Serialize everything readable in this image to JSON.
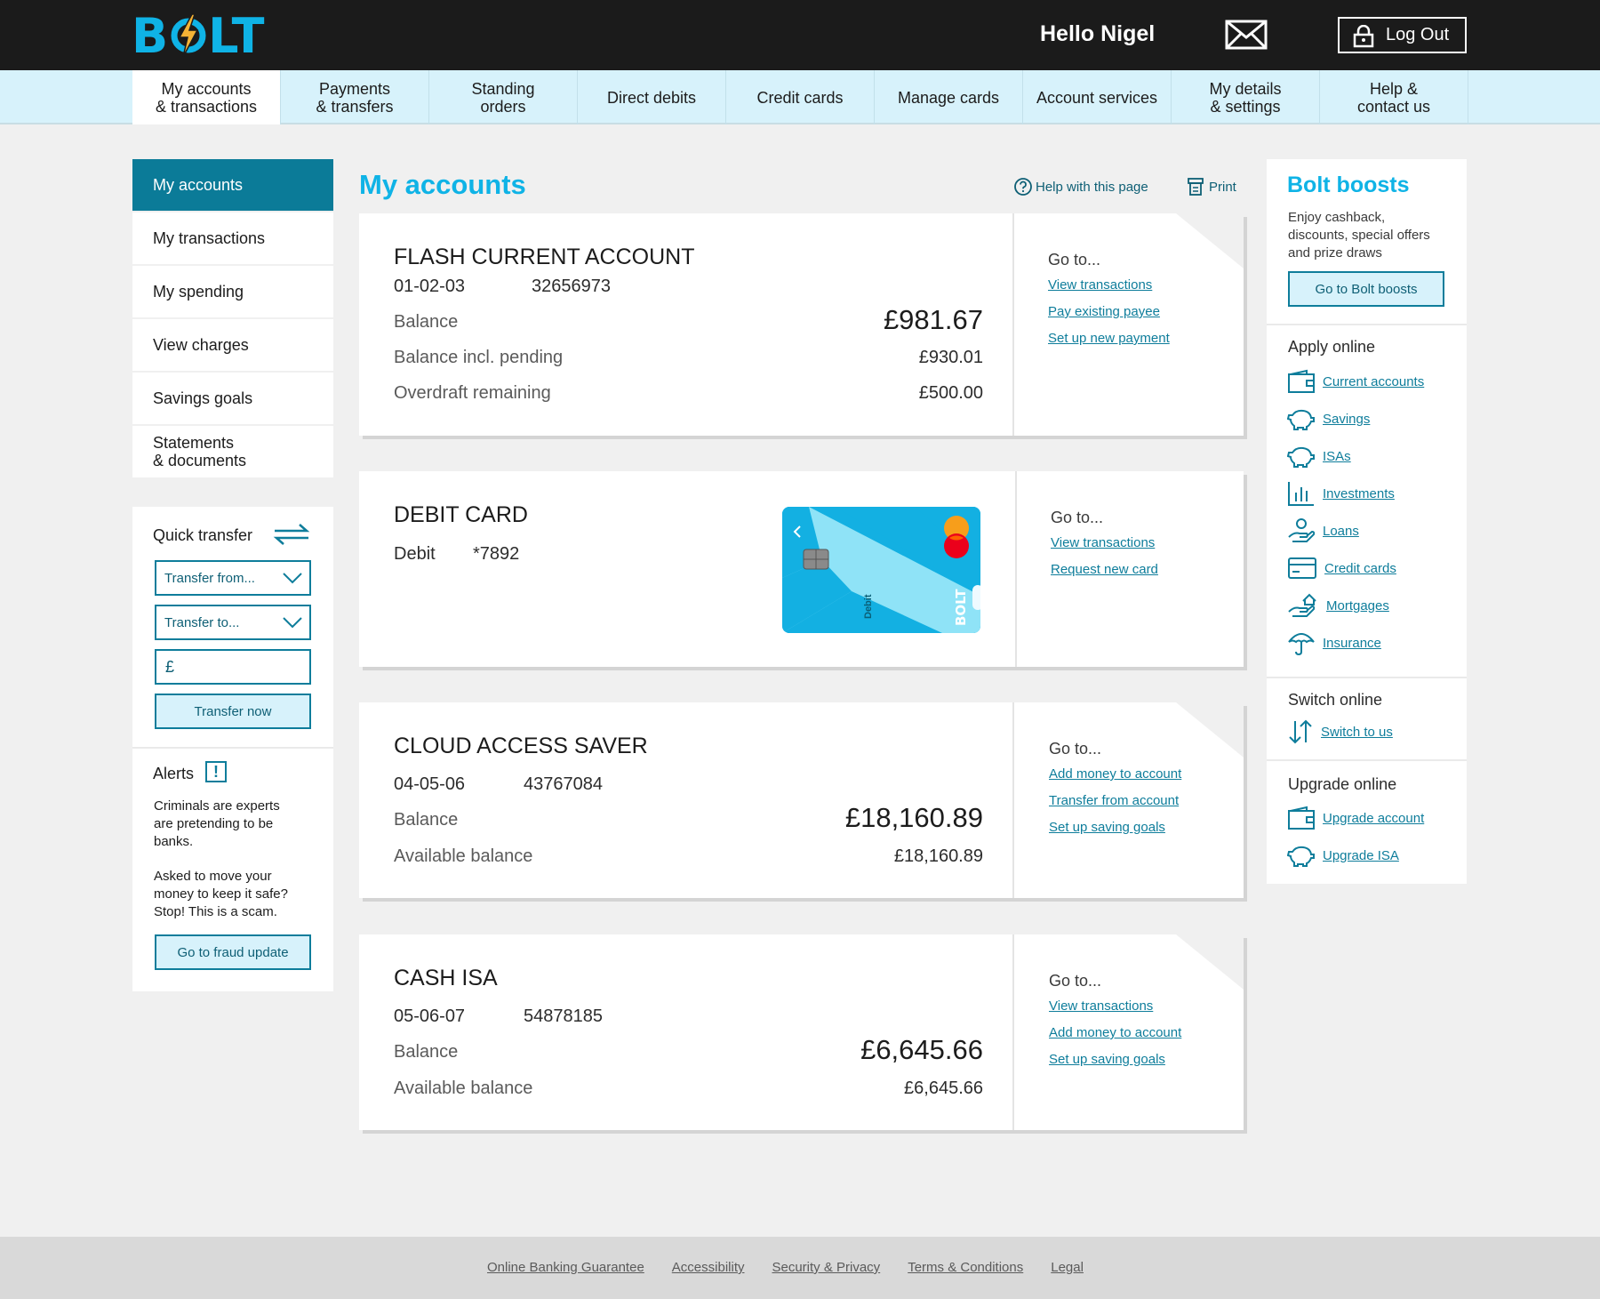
{
  "header": {
    "logo_text": "BOLT",
    "greeting": "Hello Nigel",
    "logout_label": "Log Out",
    "colors": {
      "bar": "#1b1b1b",
      "brand": "#0fb3e6",
      "bolt": "#f5b335"
    }
  },
  "nav": {
    "items": [
      {
        "label": "My accounts\n& transactions",
        "active": true
      },
      {
        "label": "Payments\n& transfers"
      },
      {
        "label": "Standing\norders"
      },
      {
        "label": "Direct debits"
      },
      {
        "label": "Credit cards"
      },
      {
        "label": "Manage cards"
      },
      {
        "label": "Account services"
      },
      {
        "label": "My details\n& settings"
      },
      {
        "label": "Help &\ncontact us"
      }
    ]
  },
  "sidebar": {
    "items": [
      {
        "label": "My accounts",
        "active": true
      },
      {
        "label": "My transactions"
      },
      {
        "label": "My spending"
      },
      {
        "label": "View charges"
      },
      {
        "label": "Savings goals"
      },
      {
        "label": "Statements\n& documents"
      }
    ],
    "quick_transfer": {
      "title": "Quick transfer",
      "from_placeholder": "Transfer from...",
      "to_placeholder": "Transfer to...",
      "amount_prefix": "£",
      "button": "Transfer now"
    },
    "alerts": {
      "title": "Alerts",
      "icon": "!",
      "text1": "Criminals are experts\nare pretending to be\nbanks.",
      "text2": "Asked to move your\nmoney to keep it safe?\nStop! This is a scam.",
      "button": "Go to fraud  update"
    }
  },
  "main": {
    "title": "My accounts",
    "help_label": "Help with this page",
    "print_label": "Print",
    "goto_title": "Go to...",
    "accounts": [
      {
        "name": "FLASH CURRENT ACCOUNT",
        "sort_code": "01-02-03",
        "number": "32656973",
        "rows": [
          {
            "label": "Balance",
            "value": "£981.67"
          },
          {
            "label": "Balance incl. pending",
            "value": "£930.01"
          },
          {
            "label": "Overdraft remaining",
            "value": "£500.00"
          }
        ],
        "links": [
          "View transactions",
          "Pay existing payee",
          "Set up new payment"
        ]
      },
      {
        "name": "DEBIT CARD",
        "card_type": "Debit",
        "card_number": "*7892",
        "card_side_text": "Debit",
        "card_logo": "BOLT",
        "links": [
          "View transactions",
          "Request new card"
        ]
      },
      {
        "name": "CLOUD ACCESS SAVER",
        "sort_code": "04-05-06",
        "number": "43767084",
        "rows": [
          {
            "label": "Balance",
            "value": "£18,160.89"
          },
          {
            "label": "Available balance",
            "value": "£18,160.89"
          }
        ],
        "links": [
          "Add money to account",
          "Transfer from account",
          "Set up saving goals"
        ]
      },
      {
        "name": "CASH ISA",
        "sort_code": "05-06-07",
        "number": "54878185",
        "rows": [
          {
            "label": "Balance",
            "value": "£6,645.66"
          },
          {
            "label": "Available balance",
            "value": "£6,645.66"
          }
        ],
        "links": [
          "View transactions",
          "Add money to account",
          "Set up saving goals"
        ]
      }
    ]
  },
  "right": {
    "title": "Bolt boosts",
    "text": "Enjoy cashback,\ndiscounts, special offers\nand prize draws",
    "button": "Go to Bolt boosts",
    "apply": {
      "title": "Apply online",
      "items": [
        {
          "label": "Current accounts",
          "icon": "wallet-icon"
        },
        {
          "label": "Savings",
          "icon": "piggy-bank-icon"
        },
        {
          "label": "ISAs",
          "icon": "piggy-bank-icon"
        },
        {
          "label": "Investments",
          "icon": "bar-chart-icon"
        },
        {
          "label": "Loans",
          "icon": "hand-coin-icon"
        },
        {
          "label": "Credit cards",
          "icon": "credit-card-icon"
        },
        {
          "label": "Mortgages",
          "icon": "hand-house-icon"
        },
        {
          "label": "Insurance",
          "icon": "umbrella-icon"
        }
      ]
    },
    "switch": {
      "title": "Switch online",
      "items": [
        {
          "label": "Switch to us",
          "icon": "switch-arrows-icon"
        }
      ]
    },
    "upgrade": {
      "title": "Upgrade online",
      "items": [
        {
          "label": "Upgrade account",
          "icon": "wallet-icon"
        },
        {
          "label": "Upgrade ISA",
          "icon": "piggy-bank-icon"
        }
      ]
    }
  },
  "footer": {
    "links": [
      "Online Banking Guarantee",
      "Accessibility",
      "Security & Privacy",
      "Terms & Conditions",
      "Legal"
    ]
  }
}
